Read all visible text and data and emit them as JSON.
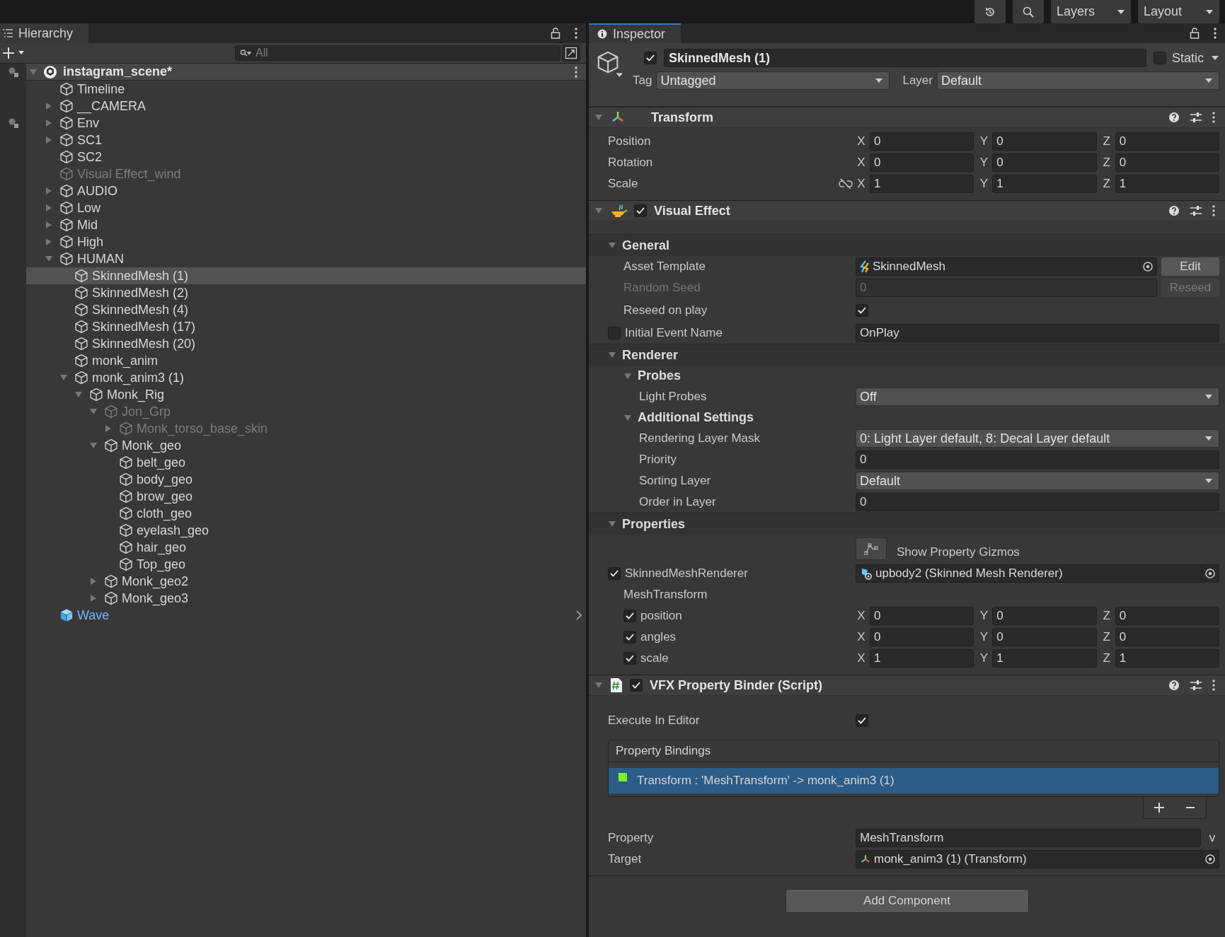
{
  "toolbar": {
    "layers": "Layers",
    "layout": "Layout"
  },
  "hierarchy": {
    "title": "Hierarchy",
    "search": {
      "placeholder": "All"
    },
    "scene": {
      "name": "instagram_scene*",
      "expanded": true,
      "gutter_icon": true,
      "children": [
        {
          "name": "Timeline",
          "kind": "object",
          "selected": false,
          "disabled": false,
          "gutter_icon": false
        },
        {
          "name": "__CAMERA",
          "kind": "object",
          "selected": false,
          "disabled": false,
          "gutter_icon": false,
          "expanded": false
        },
        {
          "name": "Env",
          "kind": "object",
          "selected": false,
          "disabled": false,
          "gutter_icon": true,
          "expanded": false
        },
        {
          "name": "SC1",
          "kind": "object",
          "selected": false,
          "disabled": false,
          "gutter_icon": false,
          "expanded": false
        },
        {
          "name": "SC2",
          "kind": "object",
          "selected": false,
          "disabled": false,
          "gutter_icon": false
        },
        {
          "name": "Visual Effect_wind",
          "kind": "object",
          "selected": false,
          "disabled": true,
          "gutter_icon": false
        },
        {
          "name": "AUDIO",
          "kind": "object",
          "selected": false,
          "disabled": false,
          "gutter_icon": false,
          "expanded": false
        },
        {
          "name": "Low",
          "kind": "object",
          "selected": false,
          "disabled": false,
          "gutter_icon": false,
          "expanded": false
        },
        {
          "name": "Mid",
          "kind": "object",
          "selected": false,
          "disabled": false,
          "gutter_icon": false,
          "expanded": false
        },
        {
          "name": "High",
          "kind": "object",
          "selected": false,
          "disabled": false,
          "gutter_icon": false,
          "expanded": false
        },
        {
          "name": "HUMAN",
          "kind": "object",
          "selected": false,
          "disabled": false,
          "gutter_icon": false,
          "expanded": true,
          "children": [
            {
              "name": "SkinnedMesh (1)",
              "kind": "object",
              "selected": true,
              "disabled": false,
              "gutter_icon": false
            },
            {
              "name": "SkinnedMesh (2)",
              "kind": "object",
              "selected": false,
              "disabled": false,
              "gutter_icon": false
            },
            {
              "name": "SkinnedMesh (4)",
              "kind": "object",
              "selected": false,
              "disabled": false,
              "gutter_icon": false
            },
            {
              "name": "SkinnedMesh (17)",
              "kind": "object",
              "selected": false,
              "disabled": false,
              "gutter_icon": false
            },
            {
              "name": "SkinnedMesh (20)",
              "kind": "object",
              "selected": false,
              "disabled": false,
              "gutter_icon": false
            },
            {
              "name": "monk_anim",
              "kind": "object",
              "selected": false,
              "disabled": false,
              "gutter_icon": false
            },
            {
              "name": "monk_anim3 (1)",
              "kind": "object",
              "selected": false,
              "disabled": false,
              "gutter_icon": false,
              "expanded": true,
              "children": [
                {
                  "name": "Monk_Rig",
                  "kind": "object",
                  "selected": false,
                  "disabled": false,
                  "gutter_icon": false,
                  "expanded": true,
                  "children": [
                    {
                      "name": "Jon_Grp",
                      "kind": "object",
                      "selected": false,
                      "disabled": true,
                      "gutter_icon": false,
                      "expanded": true,
                      "children": [
                        {
                          "name": "Monk_torso_base_skin",
                          "kind": "object",
                          "selected": false,
                          "disabled": true,
                          "gutter_icon": false,
                          "expanded": false
                        }
                      ]
                    },
                    {
                      "name": "Monk_geo",
                      "kind": "object",
                      "selected": false,
                      "disabled": false,
                      "gutter_icon": false,
                      "expanded": true,
                      "children": [
                        {
                          "name": "belt_geo",
                          "kind": "object",
                          "selected": false,
                          "disabled": false,
                          "gutter_icon": false
                        },
                        {
                          "name": "body_geo",
                          "kind": "object",
                          "selected": false,
                          "disabled": false,
                          "gutter_icon": false
                        },
                        {
                          "name": "brow_geo",
                          "kind": "object",
                          "selected": false,
                          "disabled": false,
                          "gutter_icon": false
                        },
                        {
                          "name": "cloth_geo",
                          "kind": "object",
                          "selected": false,
                          "disabled": false,
                          "gutter_icon": false
                        },
                        {
                          "name": "eyelash_geo",
                          "kind": "object",
                          "selected": false,
                          "disabled": false,
                          "gutter_icon": false
                        },
                        {
                          "name": "hair_geo",
                          "kind": "object",
                          "selected": false,
                          "disabled": false,
                          "gutter_icon": false
                        },
                        {
                          "name": "Top_geo",
                          "kind": "object",
                          "selected": false,
                          "disabled": false,
                          "gutter_icon": false
                        }
                      ]
                    },
                    {
                      "name": "Monk_geo2",
                      "kind": "object",
                      "selected": false,
                      "disabled": false,
                      "gutter_icon": false,
                      "expanded": false
                    },
                    {
                      "name": "Monk_geo3",
                      "kind": "object",
                      "selected": false,
                      "disabled": false,
                      "gutter_icon": false,
                      "expanded": false
                    }
                  ]
                }
              ]
            }
          ]
        },
        {
          "name": "Wave",
          "kind": "prefab",
          "selected": false,
          "disabled": false,
          "gutter_icon": false,
          "has_overrides_arrow": true
        }
      ]
    }
  },
  "inspector": {
    "title": "Inspector",
    "object": {
      "active": true,
      "name": "SkinnedMesh (1)",
      "static": false,
      "static_label": "Static",
      "tag_label": "Tag",
      "tag": "Untagged",
      "layer_label": "Layer",
      "layer": "Default"
    },
    "components": [
      {
        "kind": "transform",
        "title": "Transform",
        "expanded": true,
        "rows": [
          {
            "kind": "vector",
            "label": "Position",
            "constrained": false,
            "axes": [
              {
                "axis": "X",
                "value": "0"
              },
              {
                "axis": "Y",
                "value": "0"
              },
              {
                "axis": "Z",
                "value": "0"
              }
            ]
          },
          {
            "kind": "vector",
            "label": "Rotation",
            "constrained": false,
            "axes": [
              {
                "axis": "X",
                "value": "0"
              },
              {
                "axis": "Y",
                "value": "0"
              },
              {
                "axis": "Z",
                "value": "0"
              }
            ]
          },
          {
            "kind": "vector",
            "label": "Scale",
            "constrained": true,
            "axes": [
              {
                "axis": "X",
                "value": "1"
              },
              {
                "axis": "Y",
                "value": "1"
              },
              {
                "axis": "Z",
                "value": "1"
              }
            ]
          }
        ]
      },
      {
        "kind": "vfx",
        "title": "Visual Effect",
        "enabled": true,
        "expanded": true,
        "rows": [
          {
            "kind": "section",
            "label": "General",
            "expanded": true,
            "children": [
              {
                "kind": "asset",
                "label": "Asset Template",
                "value": "SkinnedMesh",
                "button": "Edit"
              },
              {
                "kind": "text",
                "label": "Random Seed",
                "value": "0",
                "disabled": true,
                "button": "Reseed"
              },
              {
                "kind": "toggle",
                "label": "Reseed on play",
                "checked": true
              },
              {
                "kind": "text",
                "label": "Initial Event Name",
                "value": "OnPlay",
                "override": false
              }
            ]
          },
          {
            "kind": "section",
            "label": "Renderer",
            "expanded": true,
            "children": [
              {
                "kind": "group",
                "label": "Probes",
                "expanded": true,
                "children": [
                  {
                    "kind": "dropdown",
                    "label": "Light Probes",
                    "value": "Off"
                  }
                ]
              },
              {
                "kind": "group",
                "label": "Additional Settings",
                "expanded": true,
                "children": [
                  {
                    "kind": "dropdown",
                    "label": "Rendering Layer Mask",
                    "value": "0: Light Layer default, 8: Decal Layer default"
                  },
                  {
                    "kind": "text",
                    "label": "Priority",
                    "value": "0"
                  },
                  {
                    "kind": "dropdown",
                    "label": "Sorting Layer",
                    "value": "Default"
                  },
                  {
                    "kind": "text",
                    "label": "Order in Layer",
                    "value": "0"
                  }
                ]
              }
            ]
          },
          {
            "kind": "section",
            "label": "Properties",
            "expanded": true,
            "children": [
              {
                "kind": "gizmo",
                "label": "Show Property Gizmos"
              },
              {
                "kind": "renderer",
                "label": "SkinnedMeshRenderer",
                "override": true,
                "value": "upbody2 (Skinned Mesh Renderer)"
              },
              {
                "kind": "caption",
                "label": "MeshTransform",
                "children": [
                  {
                    "kind": "vector",
                    "label": "position",
                    "override": true,
                    "axes": [
                      {
                        "axis": "X",
                        "value": "0"
                      },
                      {
                        "axis": "Y",
                        "value": "0"
                      },
                      {
                        "axis": "Z",
                        "value": "0"
                      }
                    ]
                  },
                  {
                    "kind": "vector",
                    "label": "angles",
                    "override": true,
                    "axes": [
                      {
                        "axis": "X",
                        "value": "0"
                      },
                      {
                        "axis": "Y",
                        "value": "0"
                      },
                      {
                        "axis": "Z",
                        "value": "0"
                      }
                    ]
                  },
                  {
                    "kind": "vector",
                    "label": "scale",
                    "override": true,
                    "axes": [
                      {
                        "axis": "X",
                        "value": "1"
                      },
                      {
                        "axis": "Y",
                        "value": "1"
                      },
                      {
                        "axis": "Z",
                        "value": "1"
                      }
                    ]
                  }
                ]
              }
            ]
          }
        ]
      },
      {
        "kind": "script",
        "title": "VFX Property Binder (Script)",
        "enabled": true,
        "expanded": true,
        "rows": [
          {
            "kind": "toggle",
            "label": "Execute In Editor",
            "checked": true
          }
        ],
        "bindings": {
          "title": "Property Bindings",
          "items": [
            {
              "text": "Transform : 'MeshTransform' -> monk_anim3 (1)",
              "color": "#7cf02a",
              "selected": true
            }
          ]
        },
        "after_rows": [
          {
            "kind": "text",
            "label": "Property",
            "value": "MeshTransform",
            "button": "v"
          },
          {
            "kind": "transform",
            "label": "Target",
            "value": "monk_anim3 (1) (Transform)"
          }
        ]
      }
    ],
    "add_component": "Add Component"
  }
}
